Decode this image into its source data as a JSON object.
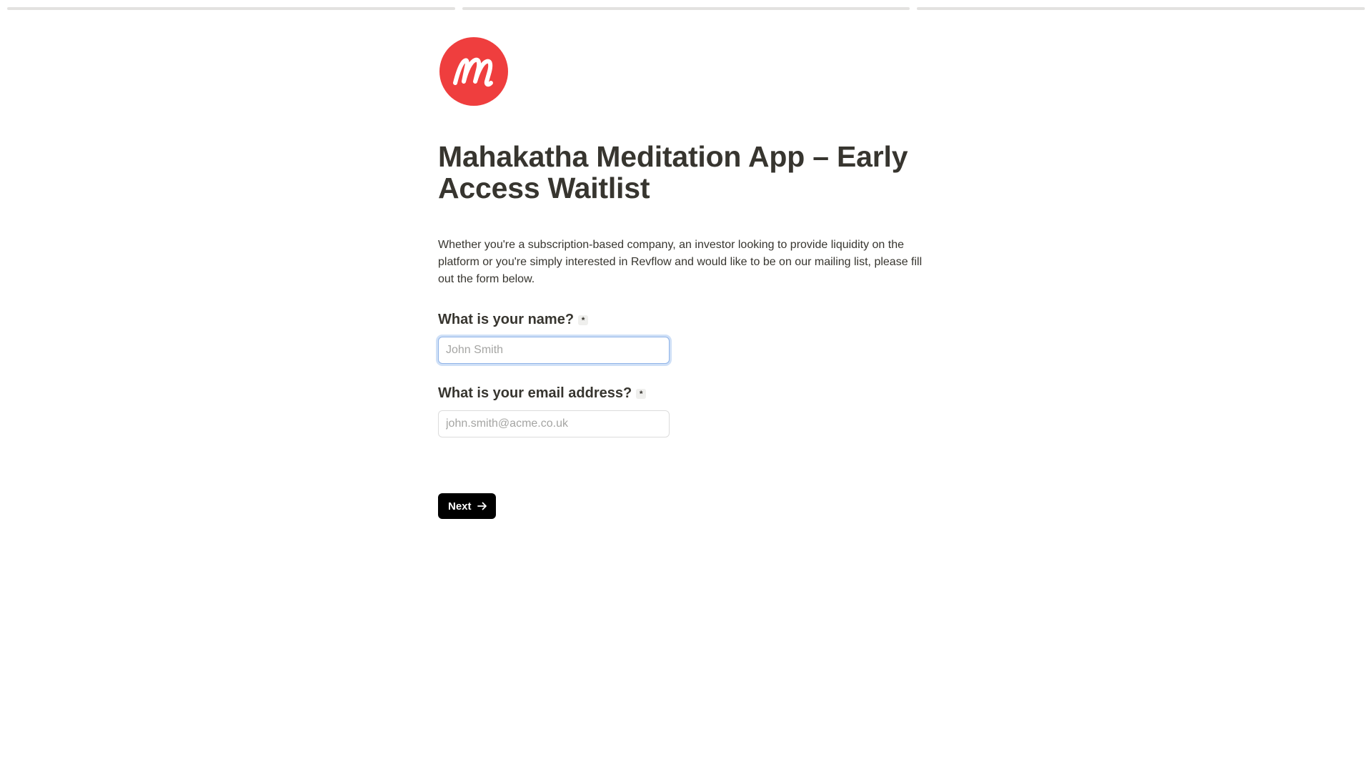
{
  "progress": {
    "segments": 3,
    "current_step": 1
  },
  "logo": {
    "icon": "mahakatha-m-logo",
    "color": "#ef3e3e"
  },
  "page": {
    "title": "Mahakatha Meditation App – Early Access Waitlist",
    "description": "Whether you're a subscription-based company, an investor looking to provide liquidity on the platform or you're simply interested in Revflow and would like to be on our mailing list, please fill out the form below."
  },
  "form": {
    "name_question": {
      "label": "What is your name?",
      "required_mark": "*",
      "placeholder": "John Smith",
      "value": ""
    },
    "email_question": {
      "label": "What is your email address?",
      "required_mark": "*",
      "placeholder": "john.smith@acme.co.uk",
      "value": ""
    },
    "next_button": {
      "label": "Next",
      "icon": "arrow-right-icon"
    }
  },
  "colors": {
    "accent": "#ef3e3e",
    "button": "#000000",
    "text": "#37352f",
    "focus_ring": "#cfe0f7"
  }
}
